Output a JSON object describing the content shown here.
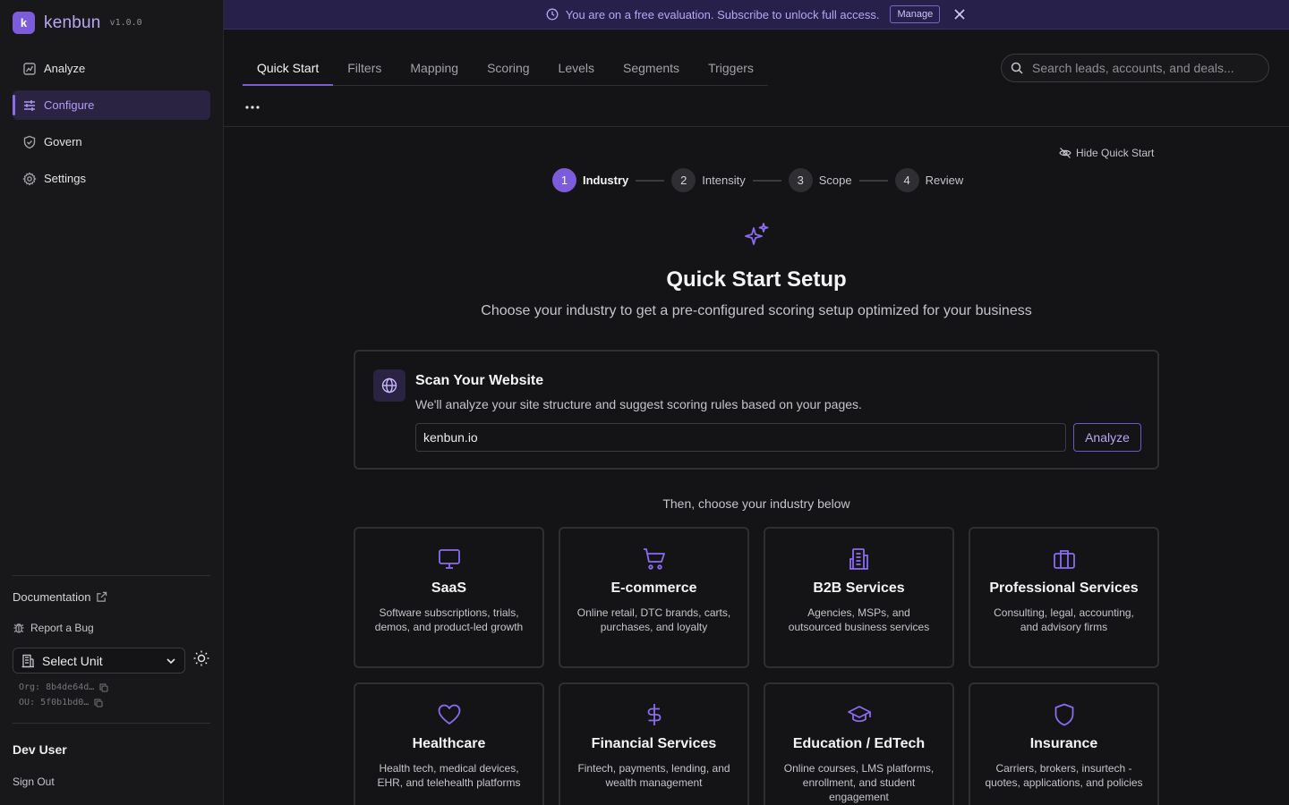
{
  "brand": {
    "logo_letter": "k",
    "name": "kenbun",
    "version": "v1.0.0"
  },
  "nav": {
    "items": [
      {
        "label": "Analyze",
        "icon": "chart-icon"
      },
      {
        "label": "Configure",
        "icon": "sliders-icon",
        "active": true
      },
      {
        "label": "Govern",
        "icon": "shield-check-icon"
      },
      {
        "label": "Settings",
        "icon": "gear-icon"
      }
    ]
  },
  "sidebar_footer": {
    "documentation": "Documentation",
    "report_bug": "Report a Bug",
    "unit_select": "Select Unit",
    "org": "Org: 8b4de64d…",
    "ou": "OU: 5f0b1bd0…",
    "user_name": "Dev User",
    "sign_out": "Sign Out"
  },
  "banner": {
    "message": "You are on a free evaluation. Subscribe to unlock full access.",
    "manage_label": "Manage"
  },
  "tabs": [
    "Quick Start",
    "Filters",
    "Mapping",
    "Scoring",
    "Levels",
    "Segments",
    "Triggers"
  ],
  "active_tab": "Quick Start",
  "search": {
    "placeholder": "Search leads, accounts, and deals..."
  },
  "quick_start": {
    "hide_label": "Hide Quick Start",
    "steps": [
      {
        "num": "1",
        "label": "Industry",
        "active": true
      },
      {
        "num": "2",
        "label": "Intensity"
      },
      {
        "num": "3",
        "label": "Scope"
      },
      {
        "num": "4",
        "label": "Review"
      }
    ],
    "title": "Quick Start Setup",
    "subtitle": "Choose your industry to get a pre-configured scoring setup optimized for your business",
    "scan": {
      "title": "Scan Your Website",
      "description": "We'll analyze your site structure and suggest scoring rules based on your pages.",
      "url_value": "kenbun.io",
      "analyze_label": "Analyze"
    },
    "then_text": "Then, choose your industry below",
    "industries": [
      {
        "title": "SaaS",
        "desc": "Software subscriptions, trials, demos, and product-led growth",
        "icon": "monitor-icon"
      },
      {
        "title": "E-commerce",
        "desc": "Online retail, DTC brands, carts, purchases, and loyalty",
        "icon": "cart-icon"
      },
      {
        "title": "B2B Services",
        "desc": "Agencies, MSPs, and outsourced business services",
        "icon": "building-icon"
      },
      {
        "title": "Professional Services",
        "desc": "Consulting, legal, accounting, and advisory firms",
        "icon": "briefcase-icon"
      },
      {
        "title": "Healthcare",
        "desc": "Health tech, medical devices, EHR, and telehealth platforms",
        "icon": "heart-icon"
      },
      {
        "title": "Financial Services",
        "desc": "Fintech, payments, lending, and wealth management",
        "icon": "dollar-icon"
      },
      {
        "title": "Education / EdTech",
        "desc": "Online courses, LMS platforms, enrollment, and student engagement",
        "icon": "graduation-cap-icon"
      },
      {
        "title": "Insurance",
        "desc": "Carriers, brokers, insurtech - quotes, applications, and policies",
        "icon": "shield-icon"
      }
    ]
  },
  "colors": {
    "accent": "#7c5cdb",
    "background": "#141416",
    "sidebar": "#18181b",
    "banner": "#27204a"
  }
}
